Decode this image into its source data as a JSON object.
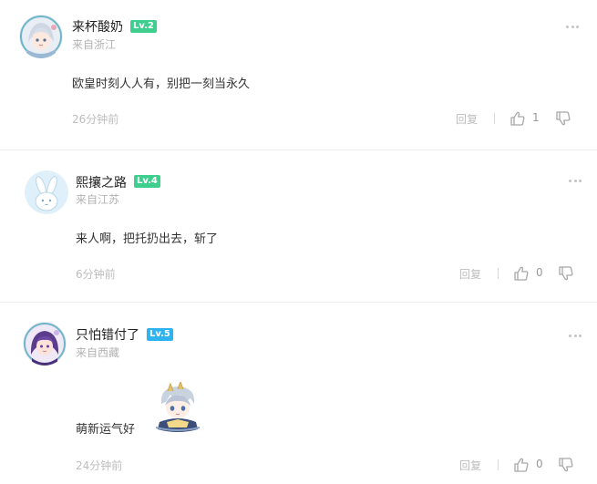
{
  "comments": [
    {
      "username": "来杯酸奶",
      "level": "Lv.2",
      "level_color": "#3ecf8e",
      "location": "来自浙江",
      "text": "欧皇时刻人人有，别把一刻当永久",
      "time": "26分钟前",
      "reply_label": "回复",
      "likes": "1",
      "avatar_icon": "anime-girl-avatar"
    },
    {
      "username": "熙攘之路",
      "level": "Lv.4",
      "level_color": "#3ecf8e",
      "location": "来自江苏",
      "text": "来人啊，把托扔出去，斩了",
      "time": "6分钟前",
      "reply_label": "回复",
      "likes": "0",
      "avatar_icon": "bunny-avatar"
    },
    {
      "username": "只怕错付了",
      "level": "Lv.5",
      "level_color": "#2fb3f0",
      "location": "来自西藏",
      "text": "萌新运气好",
      "time": "24分钟前",
      "reply_label": "回复",
      "likes": "0",
      "avatar_icon": "purple-hair-character-avatar",
      "sticker_icon": "chibi-character-sticker"
    }
  ]
}
